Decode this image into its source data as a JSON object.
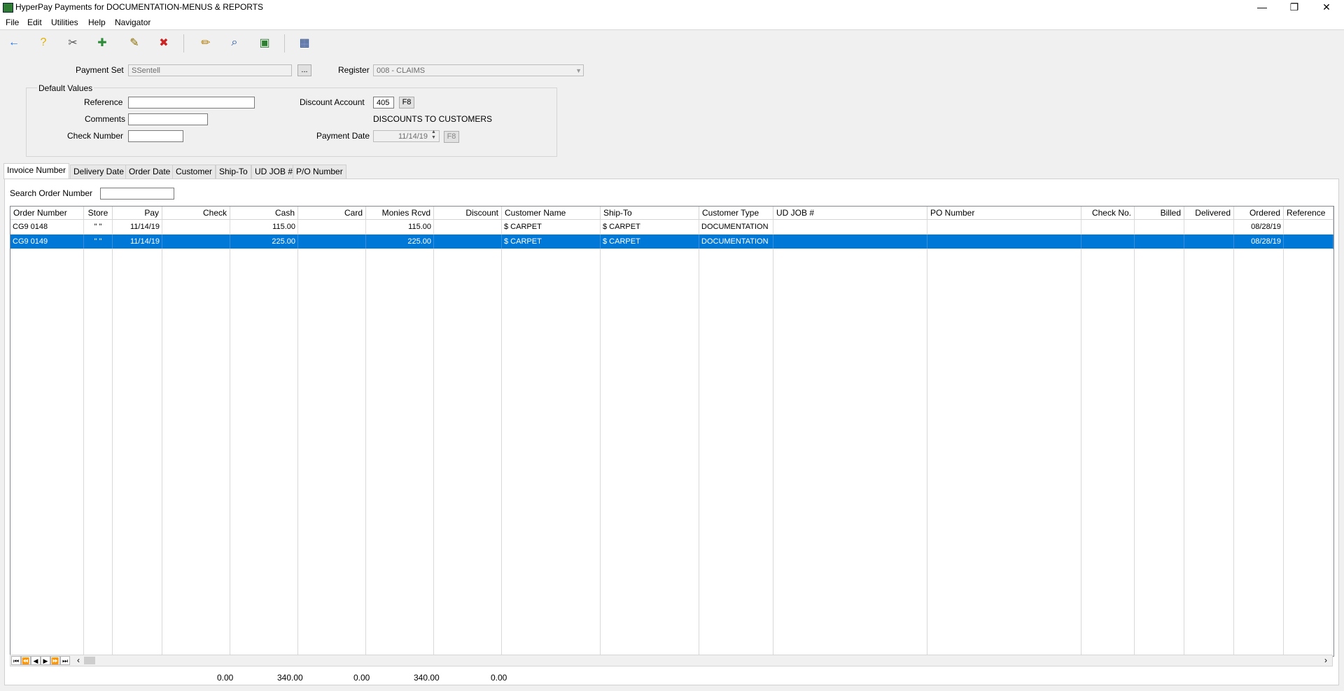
{
  "window": {
    "title": "HyperPay Payments for DOCUMENTATION-MENUS & REPORTS",
    "minimize": "—",
    "restore": "❐",
    "close": "✕"
  },
  "menu": [
    "File",
    "Edit",
    "Utilities",
    "Help",
    "Navigator"
  ],
  "toolbar": [
    {
      "name": "back-arrow-icon",
      "glyph": "←",
      "color": "#1a73e8"
    },
    {
      "name": "help-icon",
      "glyph": "?",
      "color": "#e0b000"
    },
    {
      "name": "tools-icon",
      "glyph": "✂",
      "color": "#555555"
    },
    {
      "name": "add-document-icon",
      "glyph": "✚",
      "color": "#2e8b3a"
    },
    {
      "name": "edit-document-icon",
      "glyph": "✎",
      "color": "#8a6d00"
    },
    {
      "name": "delete-document-icon",
      "glyph": "✖",
      "color": "#cc2222"
    },
    {
      "name": "pencil-icon",
      "glyph": "✏",
      "color": "#b07a00"
    },
    {
      "name": "search-document-icon",
      "glyph": "⌕",
      "color": "#1a4f9c"
    },
    {
      "name": "payment-card-icon",
      "glyph": "▣",
      "color": "#2f7d32"
    },
    {
      "name": "calculator-icon",
      "glyph": "▦",
      "color": "#1a3e8c"
    }
  ],
  "form": {
    "payment_set_label": "Payment Set",
    "payment_set_value": "SSentell",
    "ellipsis": "...",
    "register_label": "Register",
    "register_value": "008 - CLAIMS",
    "default_values_label": "Default Values",
    "reference_label": "Reference",
    "reference_value": "",
    "comments_label": "Comments",
    "comments_value": "",
    "check_number_label": "Check Number",
    "check_number_value": "",
    "discount_account_label": "Discount Account",
    "discount_account_value": "405",
    "f8": "F8",
    "discount_account_desc": "DISCOUNTS TO CUSTOMERS",
    "payment_date_label": "Payment Date",
    "payment_date_value": "11/14/19"
  },
  "tabs": [
    "Invoice Number",
    "Delivery Date",
    "Order Date",
    "Customer",
    "Ship-To",
    "UD JOB #",
    "P/O Number"
  ],
  "search": {
    "label": "Search Order Number",
    "value": ""
  },
  "grid": {
    "columns": [
      "Order Number",
      "Store",
      "Pay",
      "Check",
      "Cash",
      "Card",
      "Monies Rcvd",
      "Discount",
      "Customer Name",
      "Ship-To",
      "Customer Type",
      "UD JOB #",
      "PO Number",
      "Check No.",
      "Billed",
      "Delivered",
      "Ordered",
      "Reference"
    ],
    "rows": [
      {
        "selected": false,
        "cells": [
          "CG9 0148",
          "\" \"",
          "11/14/19",
          "",
          "115.00",
          "",
          "115.00",
          "",
          "$ CARPET",
          "$ CARPET",
          "DOCUMENTATION",
          "",
          "",
          "",
          "",
          "",
          "08/28/19",
          ""
        ]
      },
      {
        "selected": true,
        "cells": [
          "CG9 0149",
          "\" \"",
          "11/14/19",
          "",
          "225.00",
          "",
          "225.00",
          "",
          "$ CARPET",
          "$ CARPET",
          "DOCUMENTATION",
          "",
          "",
          "",
          "",
          "",
          "08/28/19",
          ""
        ]
      }
    ]
  },
  "navigator": [
    "⏮",
    "⏪",
    "◀",
    "▶",
    "⏩",
    "⏭",
    "‹",
    "›"
  ],
  "totals": {
    "check": "0.00",
    "cash": "340.00",
    "card": "0.00",
    "monies_rcvd": "340.00",
    "discount": "0.00"
  }
}
